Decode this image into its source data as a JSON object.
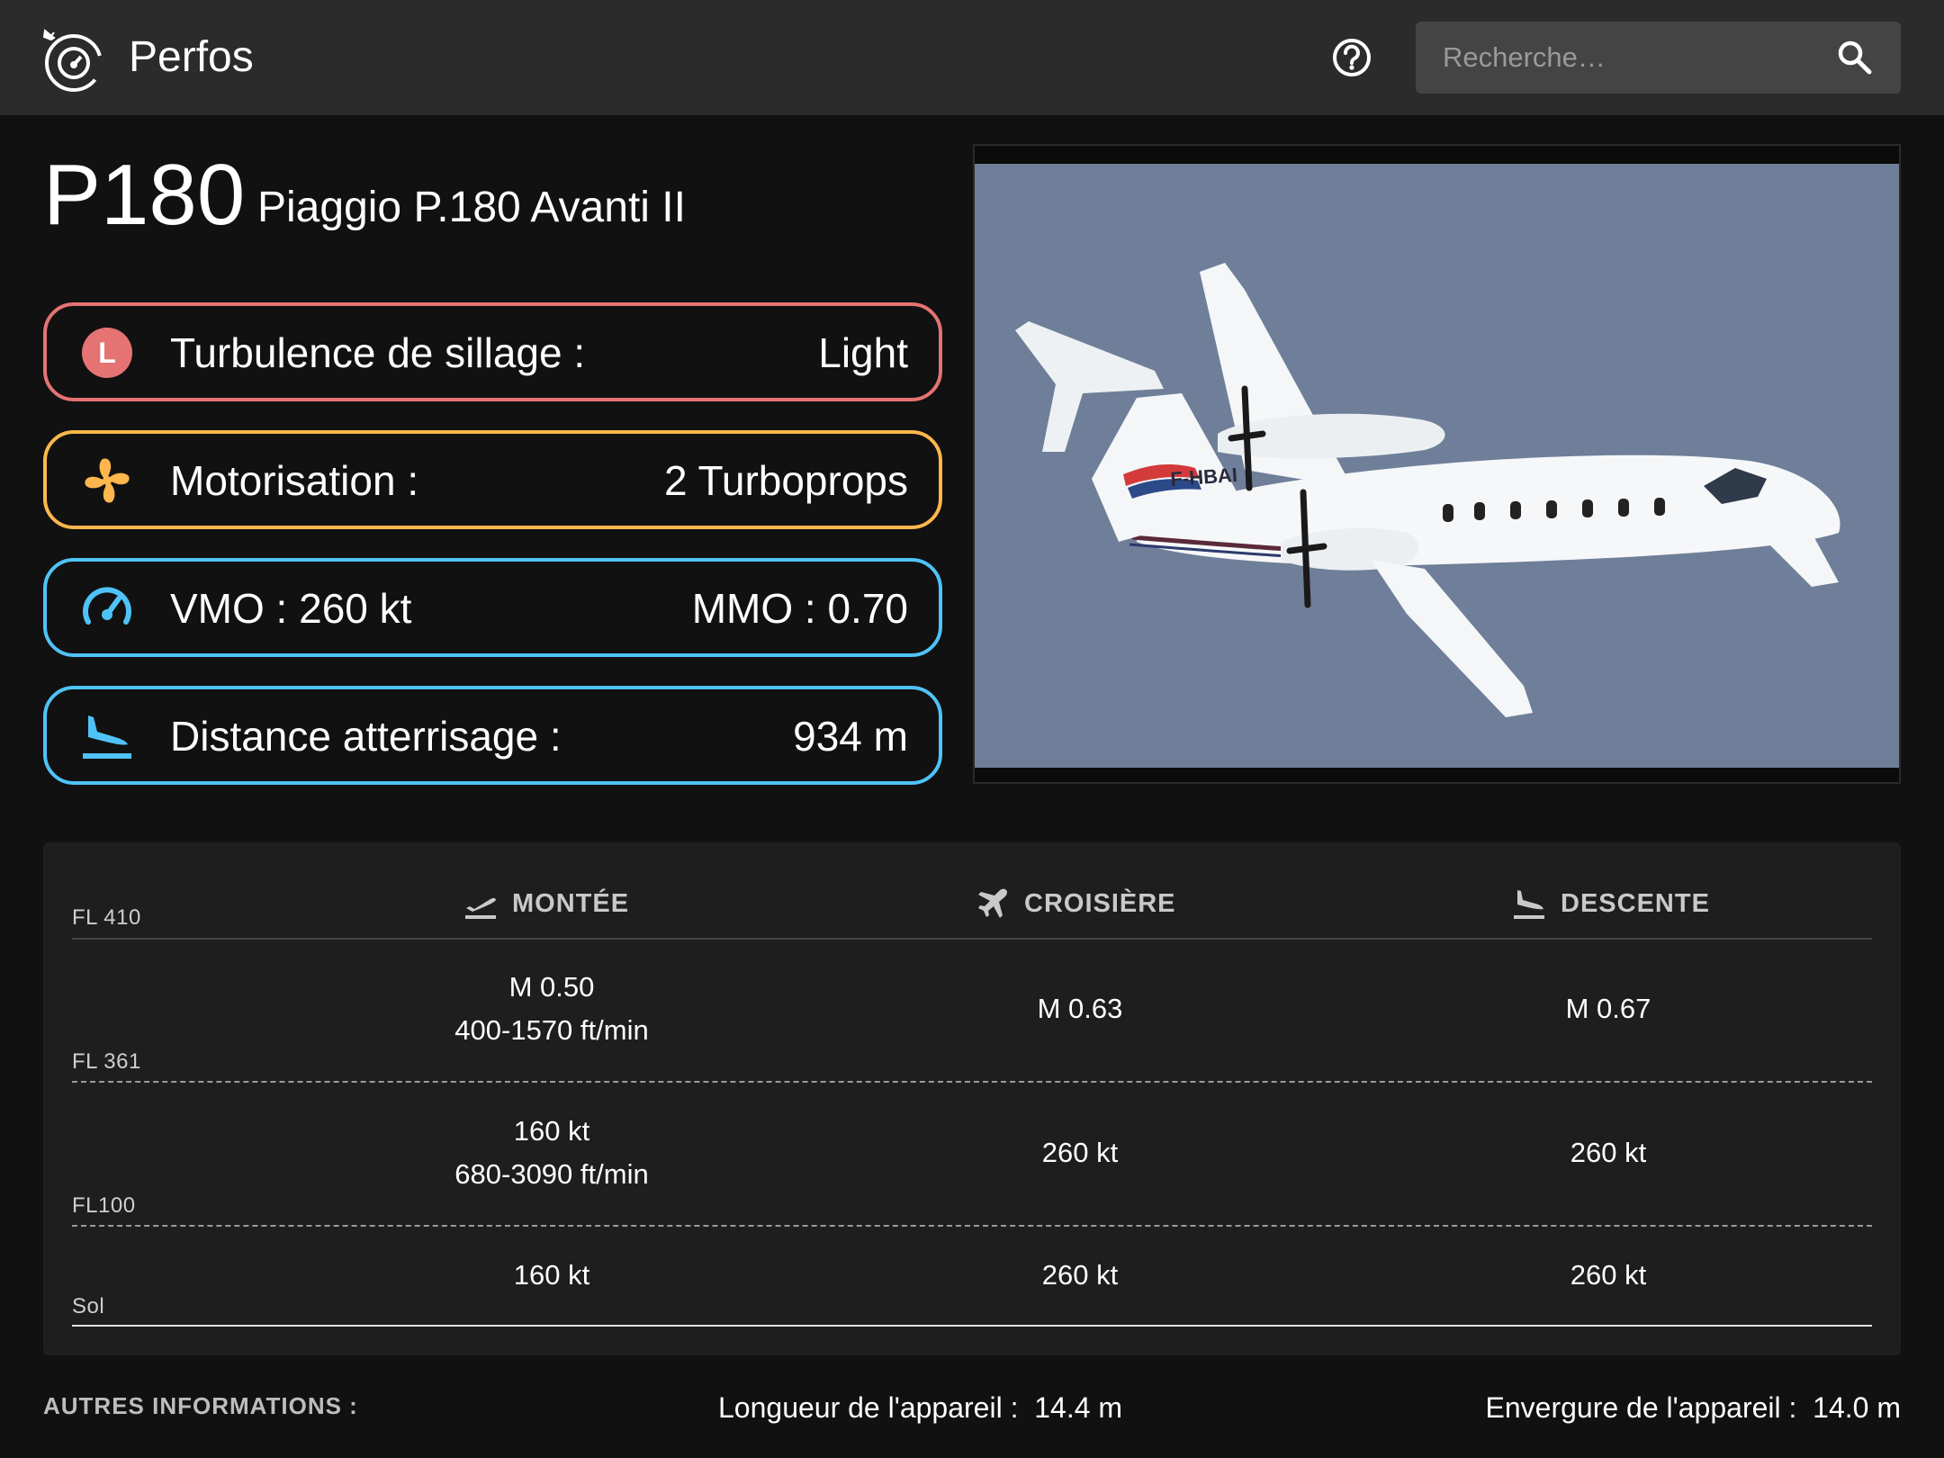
{
  "app": {
    "title": "Perfos"
  },
  "search": {
    "placeholder": "Recherche…"
  },
  "aircraft": {
    "code": "P180",
    "name": "Piaggio P.180 Avanti II"
  },
  "info": [
    {
      "label": "Turbulence de sillage :",
      "value": "Light",
      "icon": "wake-turbulence-L-icon",
      "badge": "L",
      "color": "#e57373"
    },
    {
      "label": "Motorisation :",
      "value": "2 Turboprops",
      "icon": "fan-icon",
      "color": "#ffb74d"
    },
    {
      "label": "VMO : 260 kt",
      "value": "MMO : 0.70",
      "icon": "speedometer-icon",
      "color": "#4fc3f7"
    },
    {
      "label": "Distance atterrisage :",
      "value": "934 m",
      "icon": "landing-icon",
      "color": "#4fc3f7"
    }
  ],
  "photo": {
    "registration": "F-HBAI",
    "sky_color": "#6f7f99"
  },
  "perf": {
    "columns": [
      "MONTÉE",
      "CROISIÈRE",
      "DESCENTE"
    ],
    "levels": [
      "FL 410",
      "FL 361",
      "FL100",
      "Sol"
    ],
    "rows": [
      {
        "climb_speed": "M 0.50",
        "climb_rate": "400-1570 ft/min",
        "cruise": "M 0.63",
        "descent": "M 0.67"
      },
      {
        "climb_speed": "160 kt",
        "climb_rate": "680-3090 ft/min",
        "cruise": "260 kt",
        "descent": "260 kt"
      },
      {
        "climb_speed": "160 kt",
        "climb_rate": "",
        "cruise": "260 kt",
        "descent": "260 kt"
      }
    ]
  },
  "other": {
    "title": "AUTRES INFORMATIONS :",
    "length_label": "Longueur de l'appareil :",
    "length_value": "14.4 m",
    "span_label": "Envergure de l'appareil :",
    "span_value": "14.0 m"
  }
}
